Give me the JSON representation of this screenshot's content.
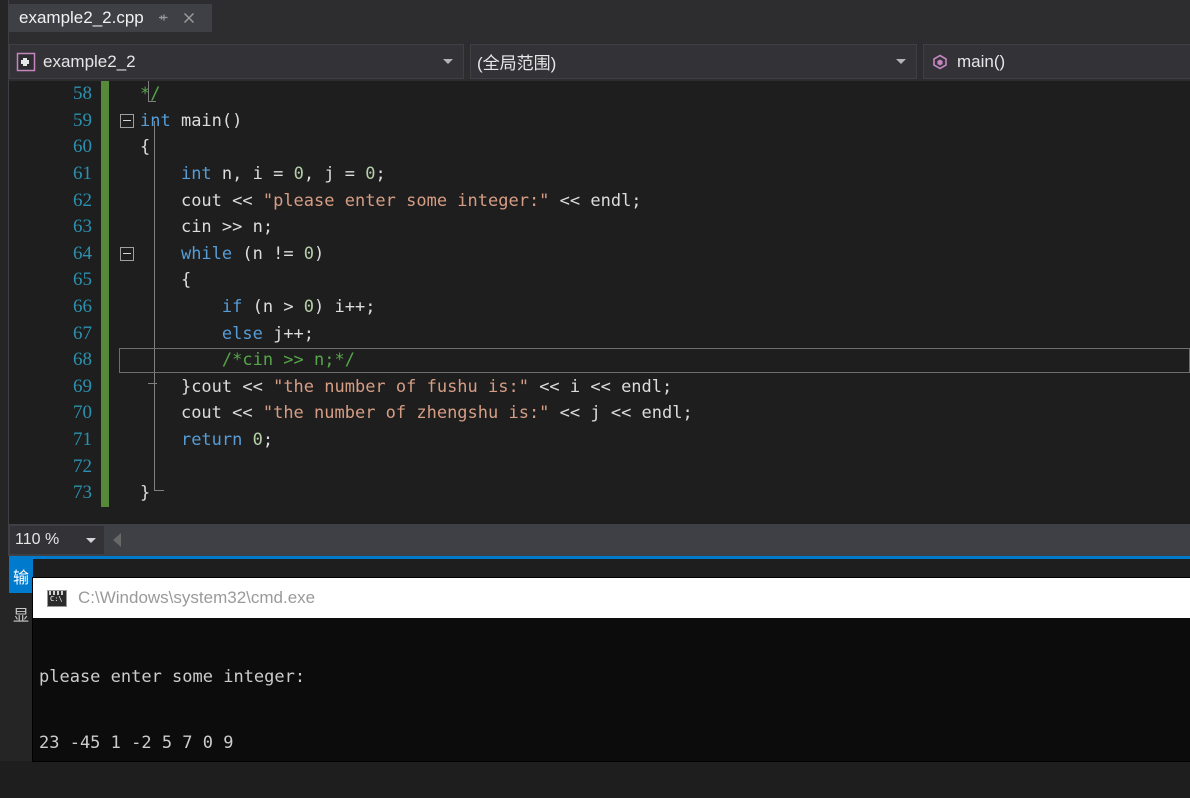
{
  "window": {
    "tab": {
      "title": "example2_2.cpp",
      "pin_icon": "pin-icon",
      "close_icon": "close-icon"
    }
  },
  "navbar": {
    "project": {
      "label": "example2_2",
      "icon": "project-icon"
    },
    "scope": {
      "label": "(全局范围)"
    },
    "member": {
      "label": "main()",
      "icon": "method-icon"
    }
  },
  "editor": {
    "current_line": 68,
    "zoom": {
      "label": "110 %",
      "arrow_icon": "chevron-down-icon"
    },
    "scroll_left_icon": "scroll-left-arrow-icon",
    "lines": [
      {
        "num": "58",
        "indent": 0,
        "tokens": [
          {
            "t": "c",
            "v": "*/"
          }
        ]
      },
      {
        "num": "59",
        "indent": 0,
        "collapse": true,
        "tokens": [
          {
            "t": "k",
            "v": "int"
          },
          {
            "t": "p",
            "v": " main()"
          }
        ]
      },
      {
        "num": "60",
        "indent": 0,
        "tokens": [
          {
            "t": "p",
            "v": "{"
          }
        ]
      },
      {
        "num": "61",
        "indent": 1,
        "tokens": [
          {
            "t": "k",
            "v": "int"
          },
          {
            "t": "p",
            "v": " n, i = "
          },
          {
            "t": "n",
            "v": "0"
          },
          {
            "t": "p",
            "v": ", j = "
          },
          {
            "t": "n",
            "v": "0"
          },
          {
            "t": "p",
            "v": ";"
          }
        ]
      },
      {
        "num": "62",
        "indent": 1,
        "tokens": [
          {
            "t": "p",
            "v": "cout << "
          },
          {
            "t": "s",
            "v": "\"please enter some integer:\""
          },
          {
            "t": "p",
            "v": " << endl;"
          }
        ]
      },
      {
        "num": "63",
        "indent": 1,
        "tokens": [
          {
            "t": "p",
            "v": "cin >> n;"
          }
        ]
      },
      {
        "num": "64",
        "indent": 1,
        "collapse": true,
        "tokens": [
          {
            "t": "k",
            "v": "while"
          },
          {
            "t": "p",
            "v": " (n != "
          },
          {
            "t": "n",
            "v": "0"
          },
          {
            "t": "p",
            "v": ")"
          }
        ]
      },
      {
        "num": "65",
        "indent": 1,
        "tokens": [
          {
            "t": "p",
            "v": "{"
          }
        ]
      },
      {
        "num": "66",
        "indent": 2,
        "tokens": [
          {
            "t": "k",
            "v": "if"
          },
          {
            "t": "p",
            "v": " (n > "
          },
          {
            "t": "n",
            "v": "0"
          },
          {
            "t": "p",
            "v": ") i++;"
          }
        ]
      },
      {
        "num": "67",
        "indent": 2,
        "tokens": [
          {
            "t": "k",
            "v": "else"
          },
          {
            "t": "p",
            "v": " j++;"
          }
        ]
      },
      {
        "num": "68",
        "indent": 2,
        "tokens": [
          {
            "t": "c",
            "v": "/*cin >> n;*/"
          }
        ]
      },
      {
        "num": "69",
        "indent": 0,
        "pre": "    ",
        "tokens": [
          {
            "t": "p",
            "v": "}cout << "
          },
          {
            "t": "s",
            "v": "\"the number of fushu is:\""
          },
          {
            "t": "p",
            "v": " << i << endl;"
          }
        ]
      },
      {
        "num": "70",
        "indent": 1,
        "tokens": [
          {
            "t": "p",
            "v": "cout << "
          },
          {
            "t": "s",
            "v": "\"the number of zhengshu is:\""
          },
          {
            "t": "p",
            "v": " << j << endl;"
          }
        ]
      },
      {
        "num": "71",
        "indent": 1,
        "tokens": [
          {
            "t": "k",
            "v": "return"
          },
          {
            "t": "p",
            "v": " "
          },
          {
            "t": "n",
            "v": "0"
          },
          {
            "t": "p",
            "v": ";"
          }
        ]
      },
      {
        "num": "72",
        "indent": 1,
        "tokens": []
      },
      {
        "num": "73",
        "indent": 0,
        "tokens": [
          {
            "t": "p",
            "v": "}"
          }
        ]
      }
    ]
  },
  "output_pane": {
    "tabs": [
      {
        "label": "输",
        "active": true
      },
      {
        "label": "显",
        "active": false
      }
    ]
  },
  "console": {
    "title": "C:\\Windows\\system32\\cmd.exe",
    "icon": "console-icon",
    "lines": [
      "please enter some integer:",
      "23 -45 1 -2 5 7 0 9"
    ]
  },
  "colors": {
    "accent": "#007acc",
    "keyword": "#569cd6",
    "string": "#d69d85",
    "number": "#b5cea8",
    "comment": "#57a64a",
    "linenumber": "#2b91af",
    "changebar": "#57893a"
  }
}
